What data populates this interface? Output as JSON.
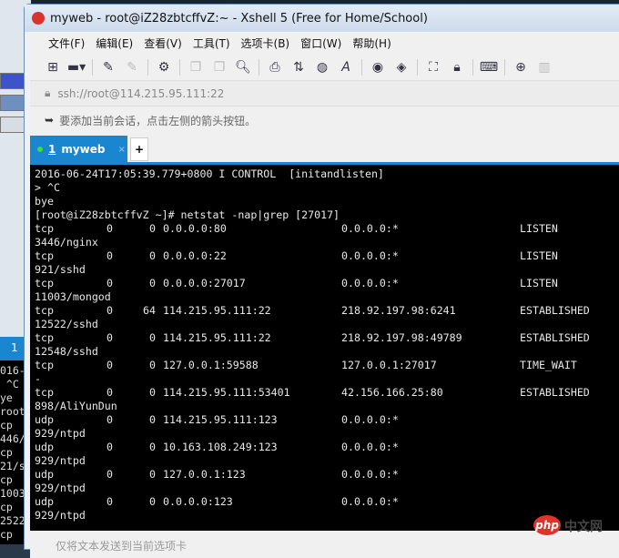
{
  "window": {
    "title": "myweb - root@iZ28zbtcffvZ:~ - Xshell 5 (Free for Home/School)"
  },
  "menu": [
    "文件(F)",
    "编辑(E)",
    "查看(V)",
    "工具(T)",
    "选项卡(B)",
    "窗口(W)",
    "帮助(H)"
  ],
  "address": "ssh://root@114.215.95.111:22",
  "hint": "要添加当前会话，点击左侧的箭头按钮。",
  "tab": {
    "number": "1",
    "label": "myweb",
    "close": "×",
    "add": "+"
  },
  "terminal": {
    "header_lines": [
      "2016-06-24T17:05:39.779+0800 I CONTROL  [initandlisten]",
      "> ^C",
      "bye",
      "[root@iZ28zbtcffvZ ~]# netstat -nap|grep [27017]"
    ],
    "rows": [
      {
        "proto": "tcp",
        "recvq": "0",
        "sendq": "0",
        "local": "0.0.0.0:80",
        "foreign": "0.0.0.0:*",
        "state": "LISTEN",
        "program": "3446/nginx"
      },
      {
        "proto": "tcp",
        "recvq": "0",
        "sendq": "0",
        "local": "0.0.0.0:22",
        "foreign": "0.0.0.0:*",
        "state": "LISTEN",
        "program": "921/sshd"
      },
      {
        "proto": "tcp",
        "recvq": "0",
        "sendq": "0",
        "local": "0.0.0.0:27017",
        "foreign": "0.0.0.0:*",
        "state": "LISTEN",
        "program": "11003/mongod"
      },
      {
        "proto": "tcp",
        "recvq": "0",
        "sendq": "64",
        "local": "114.215.95.111:22",
        "foreign": "218.92.197.98:6241",
        "state": "ESTABLISHED",
        "program": "12522/sshd"
      },
      {
        "proto": "tcp",
        "recvq": "0",
        "sendq": "0",
        "local": "114.215.95.111:22",
        "foreign": "218.92.197.98:49789",
        "state": "ESTABLISHED",
        "program": "12548/sshd"
      },
      {
        "proto": "tcp",
        "recvq": "0",
        "sendq": "0",
        "local": "127.0.0.1:59588",
        "foreign": "127.0.0.1:27017",
        "state": "TIME_WAIT",
        "program": "-"
      },
      {
        "proto": "tcp",
        "recvq": "0",
        "sendq": "0",
        "local": "114.215.95.111:53401",
        "foreign": "42.156.166.25:80",
        "state": "ESTABLISHED",
        "program": "898/AliYunDun"
      },
      {
        "proto": "udp",
        "recvq": "0",
        "sendq": "0",
        "local": "114.215.95.111:123",
        "foreign": "0.0.0.0:*",
        "state": "",
        "program": "929/ntpd"
      },
      {
        "proto": "udp",
        "recvq": "0",
        "sendq": "0",
        "local": "10.163.108.249:123",
        "foreign": "0.0.0.0:*",
        "state": "",
        "program": "929/ntpd"
      },
      {
        "proto": "udp",
        "recvq": "0",
        "sendq": "0",
        "local": "127.0.0.1:123",
        "foreign": "0.0.0.0:*",
        "state": "",
        "program": "929/ntpd"
      },
      {
        "proto": "udp",
        "recvq": "0",
        "sendq": "0",
        "local": "0.0.0.0:123",
        "foreign": "0.0.0.0:*",
        "state": "",
        "program": "929/ntpd"
      }
    ]
  },
  "bottom": "仅将文本发送到当前选项卡",
  "watermark": "php 中文网",
  "bg_window": {
    "tab": "1",
    "lines": "016-\n ^C\nye\nroot\ncp\n446/\ncp\n21/s\ncp\n1003\ncp\n2522\ncp"
  }
}
